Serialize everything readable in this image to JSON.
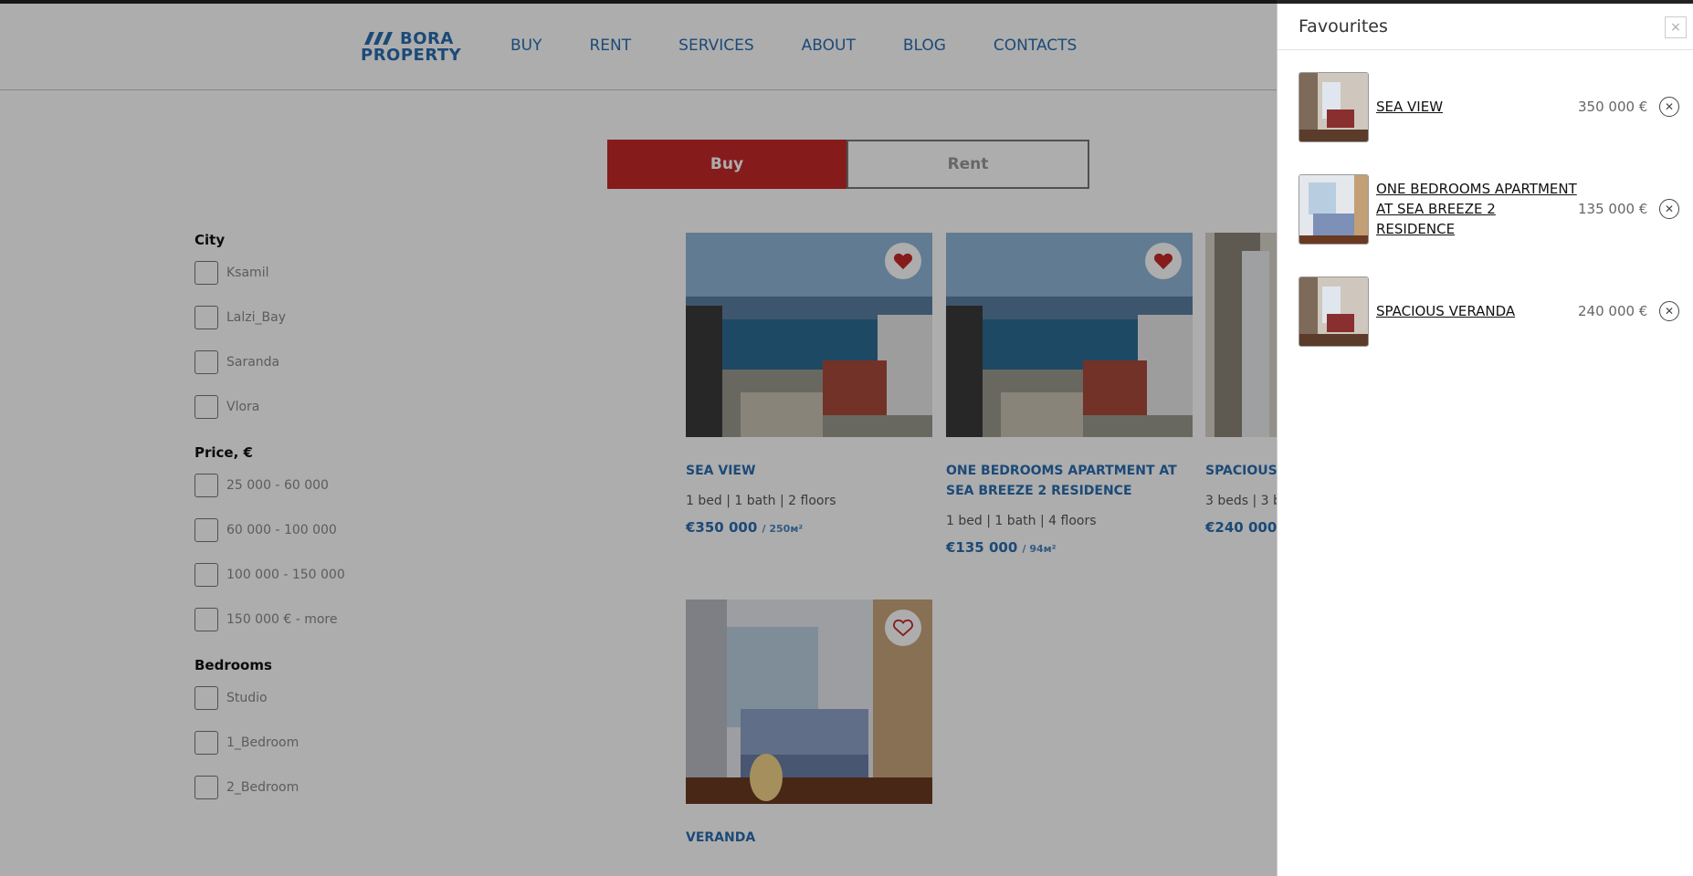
{
  "header": {
    "logo_line1": "BORA",
    "logo_line2": "PROPERTY",
    "nav": [
      "BUY",
      "RENT",
      "SERVICES",
      "ABOUT",
      "BLOG",
      "CONTACTS"
    ]
  },
  "toggle": {
    "buy": "Buy",
    "rent": "Rent",
    "active": "Buy"
  },
  "filters": {
    "city": {
      "title": "City",
      "options": [
        "Ksamil",
        "Lalzi_Bay",
        "Saranda",
        "Vlora"
      ]
    },
    "price": {
      "title": "Price, €",
      "options": [
        "25 000 - 60 000",
        "60 000 - 100 000",
        "100 000 - 150 000",
        "150 000 € - more"
      ]
    },
    "bedrooms": {
      "title": "Bedrooms",
      "options": [
        "Studio",
        "1_Bedroom",
        "2_Bedroom"
      ]
    }
  },
  "listings": [
    {
      "title": "SEA VIEW",
      "meta": "1 bed | 1 bath | 2 floors",
      "price": "€350 000",
      "area": "/ 250м²",
      "favourite": true,
      "photo": "sea-view-photo"
    },
    {
      "title": "ONE BEDROOMS APARTMENT AT SEA BREEZE 2 RESIDENCE",
      "meta": "1 bed | 1 bath | 4 floors",
      "price": "€135 000",
      "area": "/ 94м²",
      "favourite": true,
      "photo": "sea-view-photo"
    },
    {
      "title": "SPACIOUS",
      "meta": "3 beds | 3 b",
      "price": "€240 000",
      "area": "/",
      "favourite": true,
      "photo": "room-photo"
    },
    {
      "title": "VERANDA",
      "meta": "",
      "price": "",
      "area": "",
      "favourite": false,
      "photo": "bedroom-photo"
    }
  ],
  "favourites": {
    "title": "Favourites",
    "close": "×",
    "items": [
      {
        "name": "SEA VIEW",
        "price": "350 000 €"
      },
      {
        "name": "ONE BEDROOMS APARTMENT AT SEA BREEZE 2 RESIDENCE",
        "price": "135 000 €"
      },
      {
        "name": "SPACIOUS VERANDA",
        "price": "240 000 €"
      }
    ]
  },
  "colors": {
    "brand_blue": "#2a6db0",
    "accent_red": "#c62828"
  }
}
